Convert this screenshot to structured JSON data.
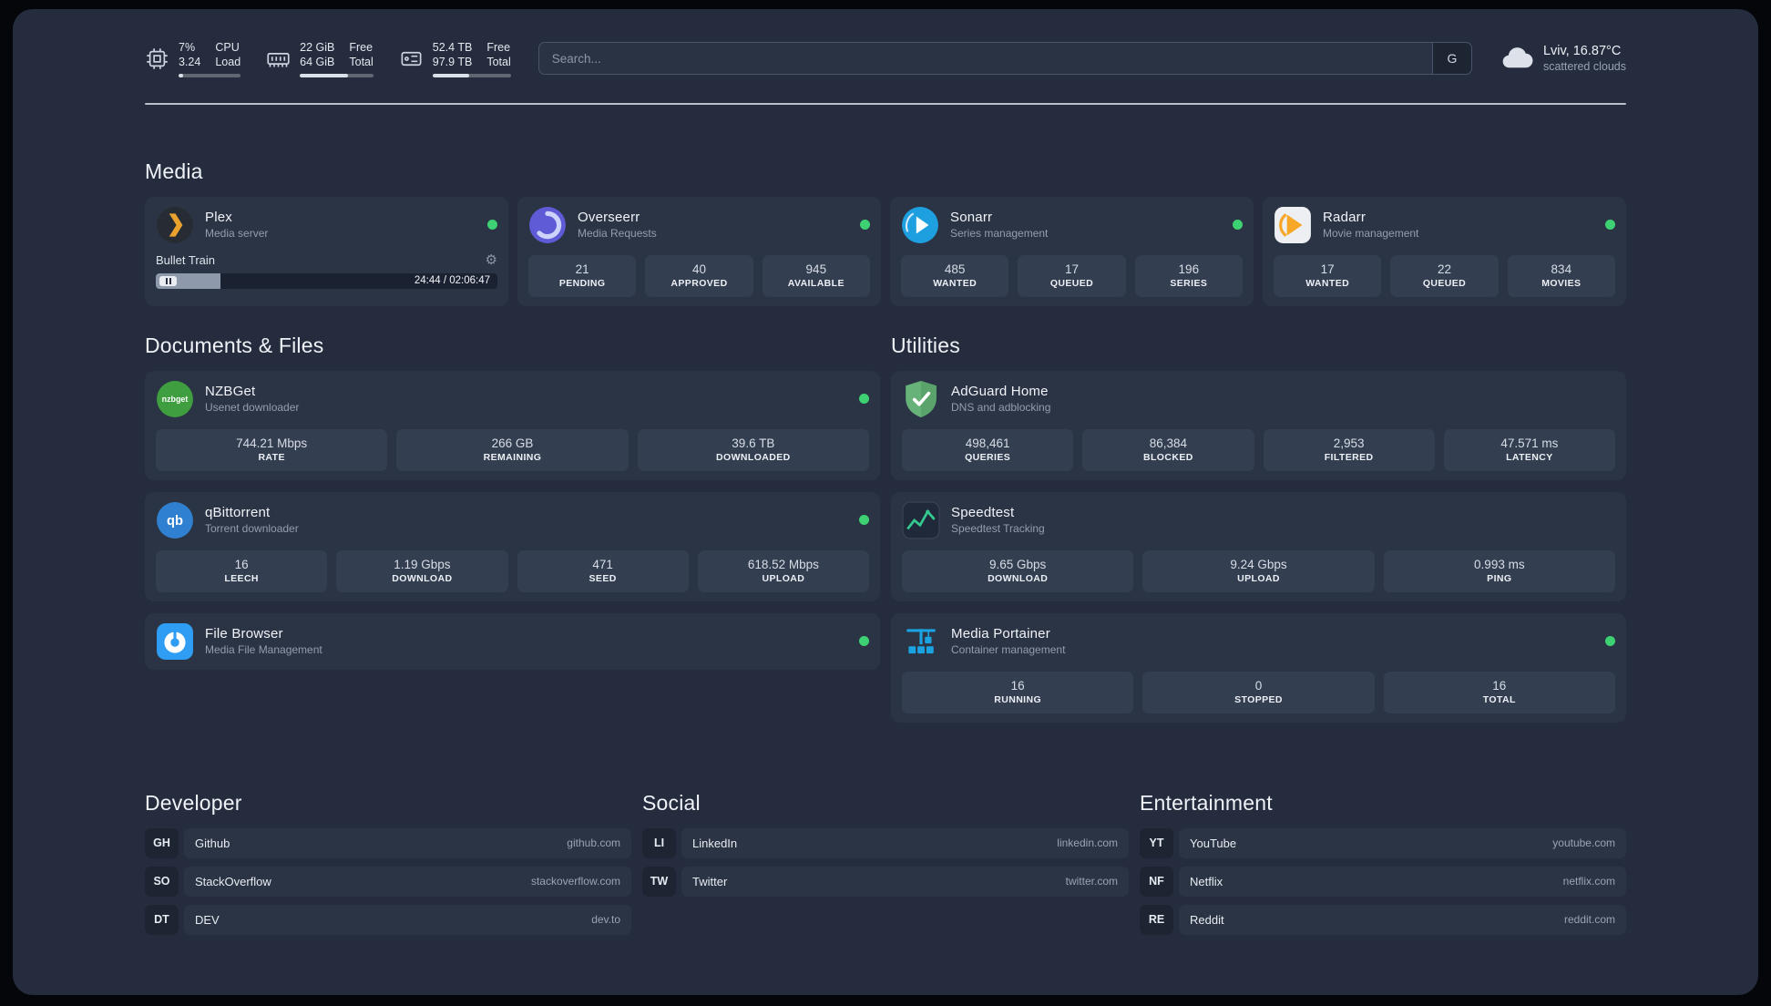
{
  "theme": {
    "background": "#242c3d",
    "card": "#2b3445",
    "stat_box": "#333e51",
    "status_online": "#3dd173",
    "plex_amber": "#e8a22d",
    "portainer_blue": "#1ba2e0",
    "adguard_green": "#67b279"
  },
  "topbar": {
    "resources": [
      {
        "value_top": "7%",
        "value_bottom": "3.24",
        "label_top": "CPU",
        "label_bottom": "Load",
        "progress": 7
      },
      {
        "value_top": "22 GiB",
        "value_bottom": "64 GiB",
        "label_top": "Free",
        "label_bottom": "Total",
        "progress": 66
      },
      {
        "value_top": "52.4 TB",
        "value_bottom": "97.9 TB",
        "label_top": "Free",
        "label_bottom": "Total",
        "progress": 47
      }
    ],
    "search": {
      "placeholder": "Search...",
      "button": "G"
    },
    "weather": {
      "location": "Lviv, 16.87°C",
      "condition": "scattered clouds"
    }
  },
  "media": {
    "title": "Media",
    "cards": [
      {
        "title": "Plex",
        "subtitle": "Media server",
        "status": "online",
        "now_playing": {
          "track": "Bullet Train",
          "time": "24:44 / 02:06:47",
          "progress": 19
        }
      },
      {
        "title": "Overseerr",
        "subtitle": "Media Requests",
        "status": "online",
        "stats": [
          {
            "value": "21",
            "label": "PENDING"
          },
          {
            "value": "40",
            "label": "APPROVED"
          },
          {
            "value": "945",
            "label": "AVAILABLE"
          }
        ]
      },
      {
        "title": "Sonarr",
        "subtitle": "Series management",
        "status": "online",
        "stats": [
          {
            "value": "485",
            "label": "WANTED"
          },
          {
            "value": "17",
            "label": "QUEUED"
          },
          {
            "value": "196",
            "label": "SERIES"
          }
        ]
      },
      {
        "title": "Radarr",
        "subtitle": "Movie management",
        "status": "online",
        "stats": [
          {
            "value": "17",
            "label": "WANTED"
          },
          {
            "value": "22",
            "label": "QUEUED"
          },
          {
            "value": "834",
            "label": "MOVIES"
          }
        ]
      }
    ]
  },
  "documents": {
    "title": "Documents & Files",
    "cards": [
      {
        "title": "NZBGet",
        "subtitle": "Usenet downloader",
        "status": "online",
        "stats": [
          {
            "value": "744.21 Mbps",
            "label": "RATE"
          },
          {
            "value": "266 GB",
            "label": "REMAINING"
          },
          {
            "value": "39.6 TB",
            "label": "DOWNLOADED"
          }
        ]
      },
      {
        "title": "qBittorrent",
        "subtitle": "Torrent downloader",
        "status": "online",
        "stats": [
          {
            "value": "16",
            "label": "LEECH"
          },
          {
            "value": "1.19 Gbps",
            "label": "DOWNLOAD"
          },
          {
            "value": "471",
            "label": "SEED"
          },
          {
            "value": "618.52 Mbps",
            "label": "UPLOAD"
          }
        ]
      },
      {
        "title": "File Browser",
        "subtitle": "Media File Management",
        "status": "online"
      }
    ]
  },
  "utilities": {
    "title": "Utilities",
    "cards": [
      {
        "title": "AdGuard Home",
        "subtitle": "DNS and adblocking",
        "stats": [
          {
            "value": "498,461",
            "label": "QUERIES"
          },
          {
            "value": "86,384",
            "label": "BLOCKED"
          },
          {
            "value": "2,953",
            "label": "FILTERED"
          },
          {
            "value": "47.571 ms",
            "label": "LATENCY"
          }
        ]
      },
      {
        "title": "Speedtest",
        "subtitle": "Speedtest Tracking",
        "stats": [
          {
            "value": "9.65 Gbps",
            "label": "DOWNLOAD"
          },
          {
            "value": "9.24 Gbps",
            "label": "UPLOAD"
          },
          {
            "value": "0.993 ms",
            "label": "PING"
          }
        ]
      },
      {
        "title": "Media Portainer",
        "subtitle": "Container management",
        "status": "online",
        "stats": [
          {
            "value": "16",
            "label": "RUNNING"
          },
          {
            "value": "0",
            "label": "STOPPED"
          },
          {
            "value": "16",
            "label": "TOTAL"
          }
        ]
      }
    ]
  },
  "bookmarks": [
    {
      "title": "Developer",
      "items": [
        {
          "abbr": "GH",
          "name": "Github",
          "url": "github.com"
        },
        {
          "abbr": "SO",
          "name": "StackOverflow",
          "url": "stackoverflow.com"
        },
        {
          "abbr": "DT",
          "name": "DEV",
          "url": "dev.to"
        }
      ]
    },
    {
      "title": "Social",
      "items": [
        {
          "abbr": "LI",
          "name": "LinkedIn",
          "url": "linkedin.com"
        },
        {
          "abbr": "TW",
          "name": "Twitter",
          "url": "twitter.com"
        }
      ]
    },
    {
      "title": "Entertainment",
      "items": [
        {
          "abbr": "YT",
          "name": "YouTube",
          "url": "youtube.com"
        },
        {
          "abbr": "NF",
          "name": "Netflix",
          "url": "netflix.com"
        },
        {
          "abbr": "RE",
          "name": "Reddit",
          "url": "reddit.com"
        }
      ]
    }
  ]
}
